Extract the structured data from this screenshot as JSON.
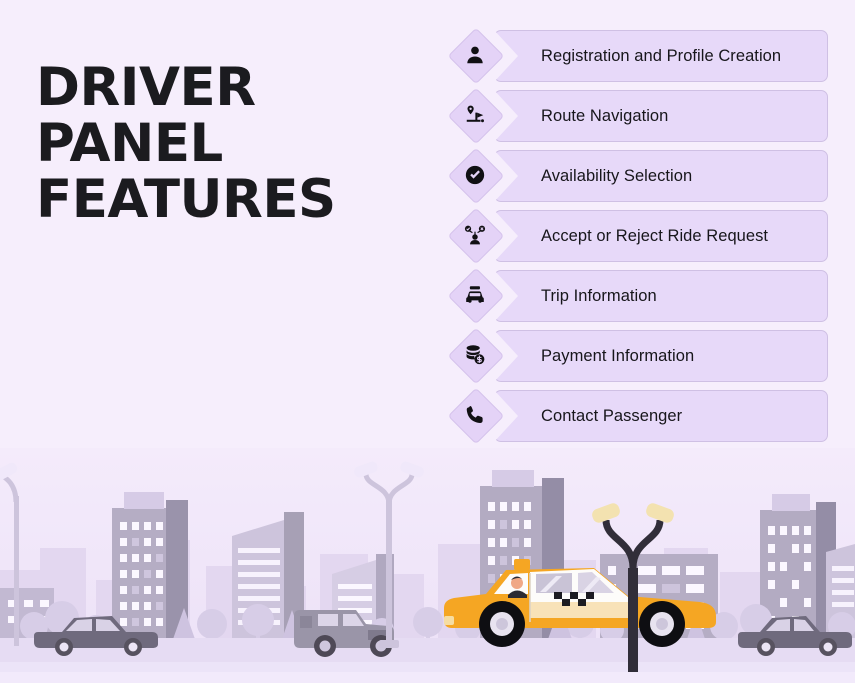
{
  "page": {
    "title": "DRIVER PANEL FEATURES",
    "title_lines": "DRIVER\nPANEL\nFEATURES",
    "background_color": "#f6eefc",
    "accent_color": "#e4d3f7",
    "pill_color": "#e7d9f9",
    "pill_border_color": "#cfc0e4",
    "text_color": "#17161b",
    "taxi_color": "#f5a623"
  },
  "features": [
    {
      "label": "Registration and Profile Creation",
      "icon": "user-icon"
    },
    {
      "label": "Route Navigation",
      "icon": "route-navigation-icon"
    },
    {
      "label": "Availability Selection",
      "icon": "check-circle-icon"
    },
    {
      "label": "Accept or Reject Ride Request",
      "icon": "accept-reject-person-icon"
    },
    {
      "label": "Trip Information",
      "icon": "car-icon"
    },
    {
      "label": "Payment Information",
      "icon": "coins-dollar-icon"
    },
    {
      "label": "Contact Passenger",
      "icon": "phone-icon"
    }
  ],
  "illustration": {
    "name": "city-street-scene",
    "sky_color": "#f2e8fa",
    "road_color": "#e7ddf4",
    "sidewalk_color": "#f1e9fb",
    "building_far_color": "#e0d3ee",
    "building_mid_color": "#c9bfd8",
    "building_near_color": "#a7a0b5",
    "tree_color": "#d9cfe8",
    "car_dark_color": "#6f6a7d",
    "car_grey_color": "#9a95a8",
    "lamp_color": "#2f2c36",
    "lamp_light_color": "#f3e2b0"
  }
}
